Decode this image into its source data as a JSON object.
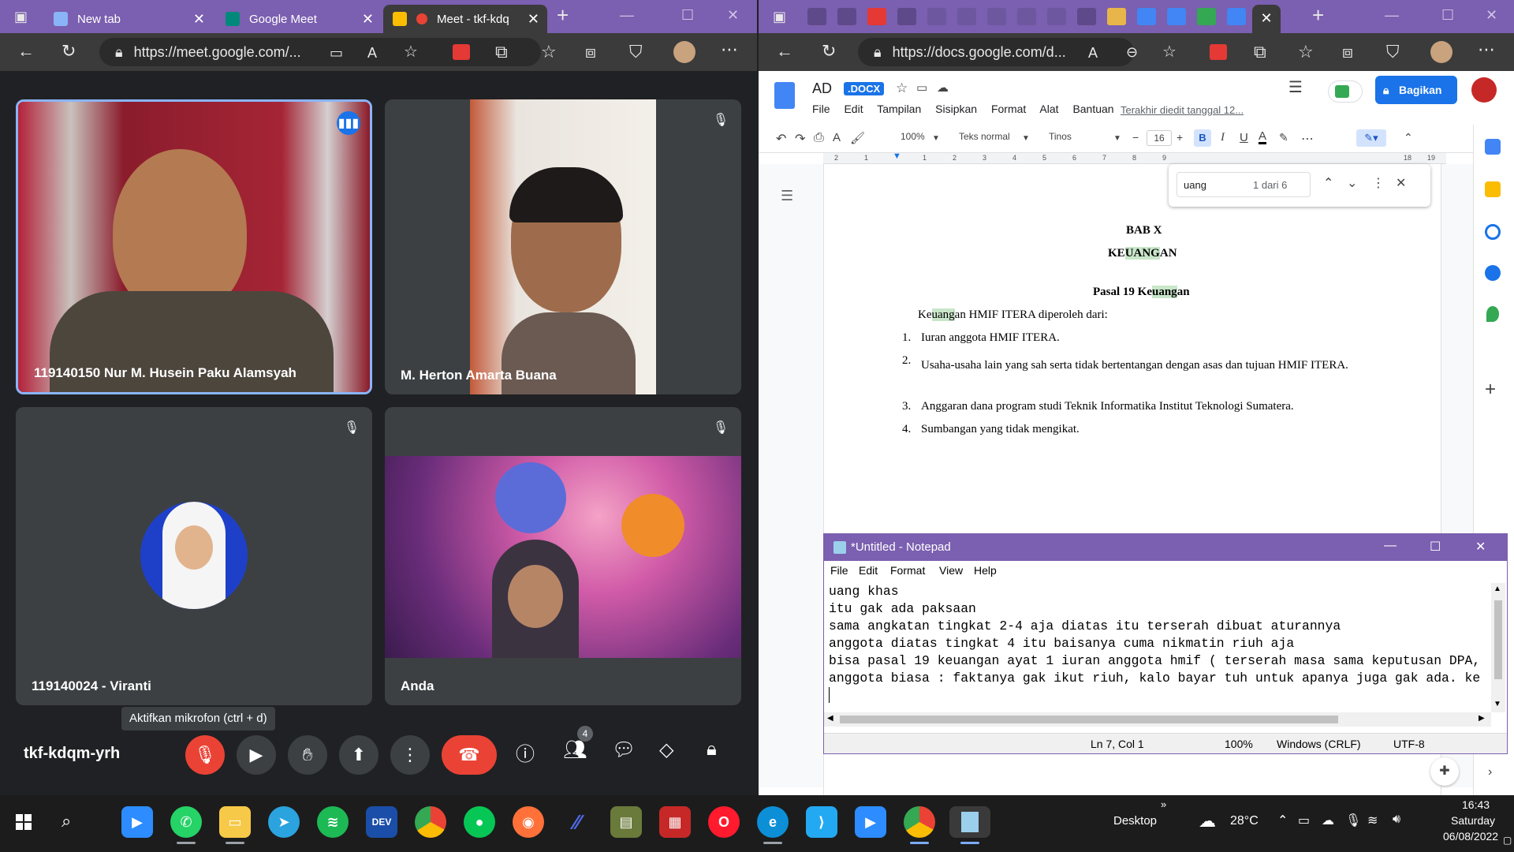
{
  "left_browser": {
    "tabs": [
      {
        "label": "New tab",
        "favicon_color": "#8ab4f8"
      },
      {
        "label": "Google Meet",
        "favicon_color": "#00897b"
      },
      {
        "label": "Meet - tkf-kdq",
        "favicon_color": "#fbbc04"
      }
    ],
    "url": "https://meet.google.com/..."
  },
  "meet": {
    "participants": [
      {
        "name": "119140150 Nur M. Husein Paku Alamsyah",
        "video": true,
        "speaking": true
      },
      {
        "name": "M. Herton Amarta Buana",
        "video": true,
        "muted": true
      },
      {
        "name": "119140024 - Viranti",
        "video": false,
        "muted": true
      },
      {
        "name": "Anda",
        "video": true,
        "muted": true
      }
    ],
    "meeting_code": "tkf-kdqm-yrh",
    "tooltip": "Aktifkan mikrofon (ctrl + d)",
    "people_count": "4"
  },
  "right_browser": {
    "url": "https://docs.google.com/d...",
    "doc": {
      "title": "AD",
      "badge": ".DOCX",
      "menus": [
        "File",
        "Edit",
        "Tampilan",
        "Sisipkan",
        "Format",
        "Alat",
        "Bantuan"
      ],
      "last_edit": "Terakhir diedit tanggal 12...",
      "share_label": "Bagikan",
      "zoom": "100%",
      "style": "Teks normal",
      "font": "Tinos",
      "font_size": "16",
      "find_query": "uang",
      "find_count": "1 dari 6",
      "ruler_marks": [
        "2",
        "1",
        "1",
        "2",
        "3",
        "4",
        "5",
        "6",
        "7",
        "8",
        "9",
        "18",
        "19"
      ],
      "chapter": "BAB X",
      "chapter_title": "KEUANGAN",
      "pasal": "Pasal 19 Keuangan",
      "intro": "Keuangan HMIF ITERA diperoleh dari:",
      "items": [
        "Iuran anggota HMIF ITERA.",
        "Usaha-usaha lain yang sah serta tidak bertentangan dengan asas dan tujuan HMIF ITERA.",
        "Anggaran dana program studi Teknik Informatika Institut Teknologi Sumatera.",
        "Sumbangan yang tidak mengikat."
      ]
    }
  },
  "notepad": {
    "title": "*Untitled - Notepad",
    "menus": [
      "File",
      "Edit",
      "Format",
      "View",
      "Help"
    ],
    "lines": [
      "uang khas",
      "itu gak ada paksaan",
      "sama angkatan tingkat 2-4 aja diatas itu terserah dibuat aturannya",
      "anggota diatas tingkat 4 itu baisanya cuma nikmatin riuh aja",
      "bisa pasal 19 keuangan ayat 1 iuran anggota hmif ( terserah masa sama keputusan DPA,",
      "anggota biasa : faktanya gak ikut riuh, kalo bayar tuh untuk apanya juga gak ada. ke"
    ],
    "status": {
      "position": "Ln 7, Col 1",
      "zoom": "100%",
      "eol": "Windows (CRLF)",
      "encoding": "UTF-8"
    }
  },
  "taskbar": {
    "desktop_label": "Desktop",
    "weather": "28°C",
    "time": "16:43",
    "day": "Saturday",
    "date": "06/08/2022",
    "devpost_label": "DEV"
  }
}
